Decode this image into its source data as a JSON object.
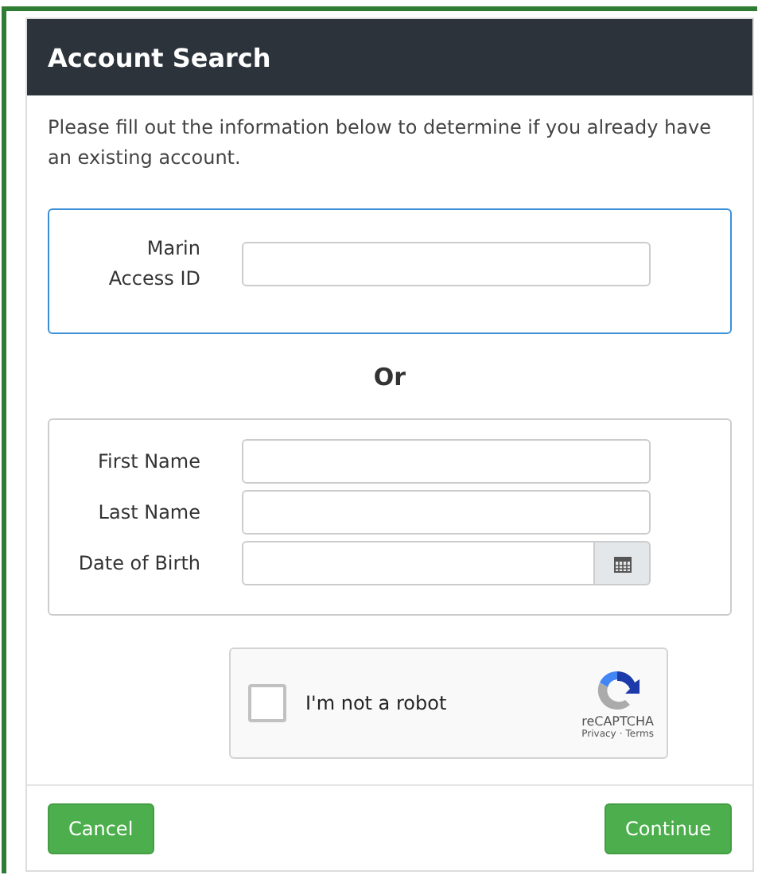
{
  "dialog": {
    "title": "Account Search"
  },
  "intro": "Please fill out the information below to determine if you already have an existing account.",
  "id_section": {
    "fields": [
      {
        "label": "Marin Access ID",
        "kind": "text"
      }
    ]
  },
  "separator": "Or",
  "name_section": {
    "fields": [
      {
        "label": "First Name",
        "kind": "text"
      },
      {
        "label": "Last Name",
        "kind": "text"
      },
      {
        "label": "Date of Birth",
        "kind": "date"
      }
    ]
  },
  "captcha": {
    "label": "I'm not a robot",
    "checked": false,
    "brand": "reCAPTCHA",
    "privacy": "Privacy",
    "dot": "·",
    "terms": "Terms"
  },
  "buttons": [
    {
      "label": "Cancel"
    },
    {
      "label": "Continue"
    }
  ]
}
